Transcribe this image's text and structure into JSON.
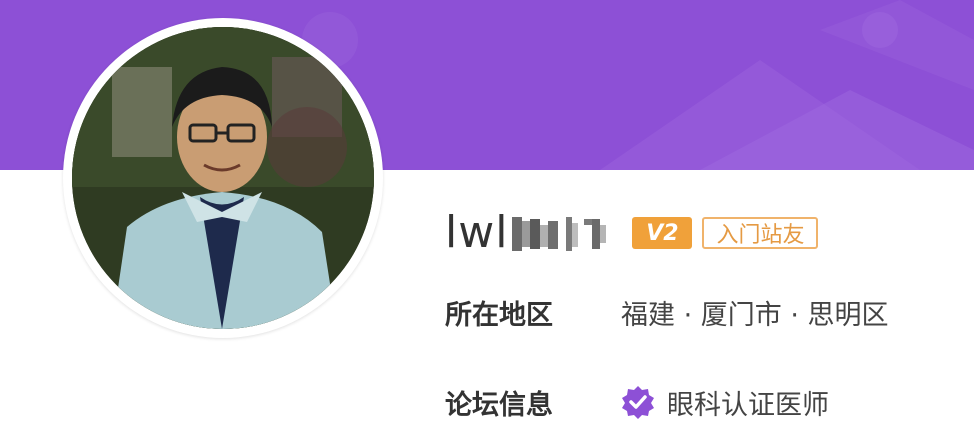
{
  "profile": {
    "username_visible": "lwl",
    "username_obscured": "a blurred / mosaic tail",
    "level_badge": "V2",
    "rank_badge": "入门站友"
  },
  "info": {
    "region_label": "所在地区",
    "region_value": "福建 · 厦门市 · 思明区",
    "forum_label": "论坛信息",
    "forum_value": "眼科认证医师",
    "verify_icon": "verified-check-icon"
  },
  "colors": {
    "banner": "#8d50d6",
    "level_badge": "#f0a13a",
    "rank_border": "#f0b36b",
    "rank_text": "#e59a43",
    "verify_icon": "#8d50d6"
  }
}
